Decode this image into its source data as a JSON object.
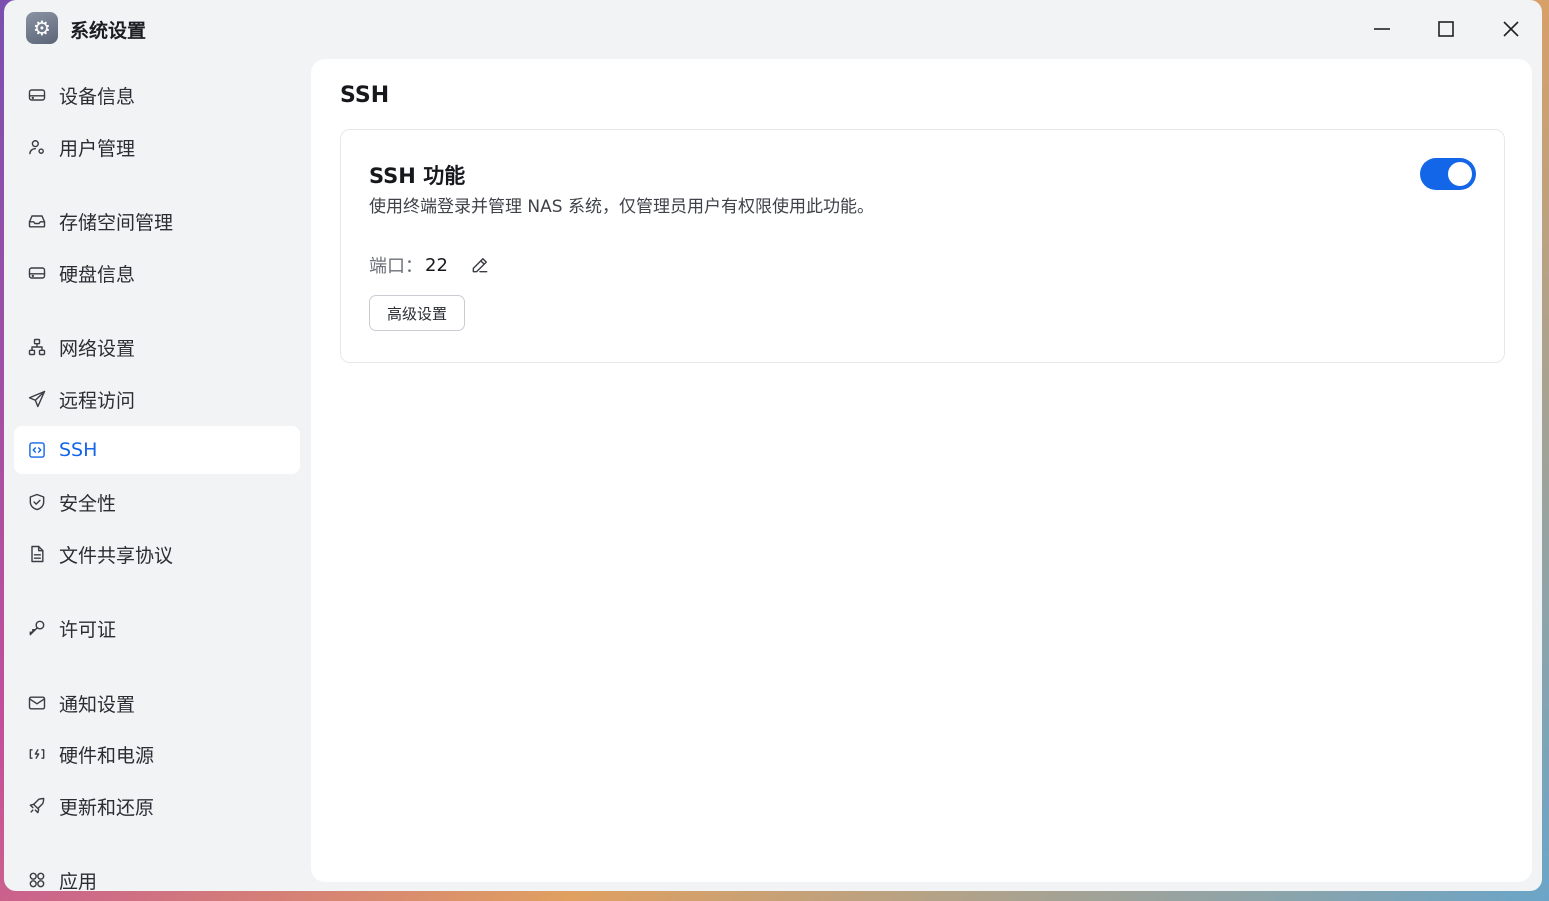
{
  "window": {
    "title": "系统设置",
    "icon": "gear-icon",
    "controls": [
      "minimize-icon",
      "maximize-icon",
      "close-icon"
    ]
  },
  "sidebar": {
    "items": [
      {
        "label": "设备信息",
        "icon": "drive-icon",
        "active": false
      },
      {
        "label": "用户管理",
        "icon": "user-gear-icon",
        "active": false
      },
      {
        "label": "存储空间管理",
        "icon": "inbox-icon",
        "active": false
      },
      {
        "label": "硬盘信息",
        "icon": "hard-disk-icon",
        "active": false
      },
      {
        "label": "网络设置",
        "icon": "network-icon",
        "active": false
      },
      {
        "label": "远程访问",
        "icon": "send-icon",
        "active": false
      },
      {
        "label": "SSH",
        "icon": "terminal-icon",
        "active": true
      },
      {
        "label": "安全性",
        "icon": "shield-icon",
        "active": false
      },
      {
        "label": "文件共享协议",
        "icon": "document-icon",
        "active": false
      },
      {
        "label": "许可证",
        "icon": "key-icon",
        "active": false
      },
      {
        "label": "通知设置",
        "icon": "mail-icon",
        "active": false
      },
      {
        "label": "硬件和电源",
        "icon": "power-icon",
        "active": false
      },
      {
        "label": "更新和还原",
        "icon": "rocket-icon",
        "active": false
      },
      {
        "label": "应用",
        "icon": "apps-grid-icon",
        "active": false
      }
    ]
  },
  "main": {
    "title": "SSH",
    "card": {
      "title": "SSH 功能",
      "description": "使用终端登录并管理 NAS 系统，仅管理员用户有权限使用此功能。",
      "enabled": true,
      "port_label": "端口：",
      "port_value": "22",
      "advanced_button": "高级设置"
    }
  },
  "colors": {
    "accent": "#1366e8",
    "sidebar_bg": "#f2f3f5",
    "content_bg": "#ffffff"
  }
}
